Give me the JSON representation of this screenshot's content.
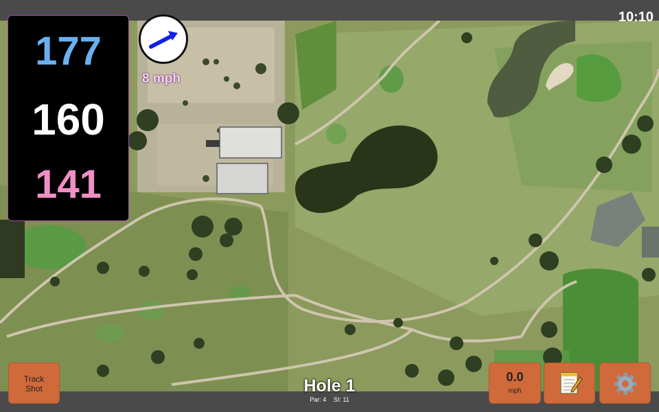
{
  "status": {
    "time": "10:10"
  },
  "yardages": {
    "back": "177",
    "middle": "160",
    "front": "141",
    "back_color": "#6ab0f0",
    "middle_color": "#ffffff",
    "front_color": "#f08fc6"
  },
  "wind": {
    "speed_label": "8 mph",
    "direction_icon": "arrow-icon",
    "arrow_color": "#1322e0"
  },
  "buttons": {
    "track_shot_line1": "Track",
    "track_shot_line2": "Shot",
    "wind_value": "0.0",
    "wind_unit": "mph",
    "notes_icon": "notepad-icon",
    "settings_icon": "gear-icon",
    "accent": "#d06a3a"
  },
  "hole": {
    "title": "Hole 1",
    "par": "Par: 4",
    "stroke_index": "SI: 11"
  }
}
